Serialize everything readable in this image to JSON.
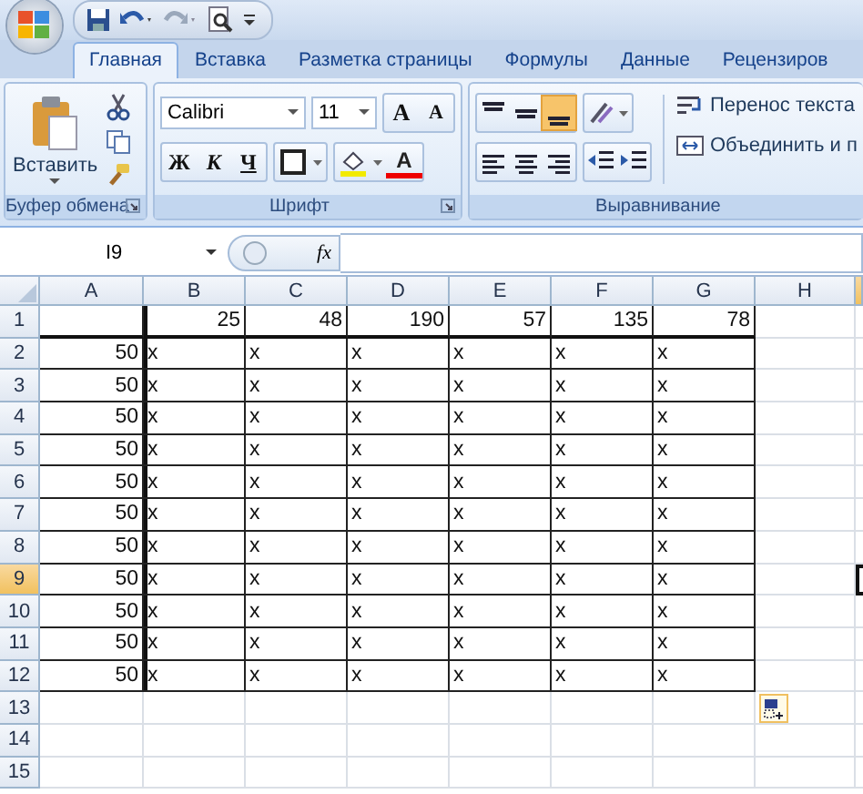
{
  "tabs": [
    {
      "label": "Главная",
      "selected": true
    },
    {
      "label": "Вставка",
      "selected": false
    },
    {
      "label": "Разметка страницы",
      "selected": false
    },
    {
      "label": "Формулы",
      "selected": false
    },
    {
      "label": "Данные",
      "selected": false
    },
    {
      "label": "Рецензиров",
      "selected": false
    }
  ],
  "ribbon": {
    "clipboard": {
      "paste_label": "Вставить",
      "group_label": "Буфер обмена"
    },
    "font": {
      "font_name": "Calibri",
      "font_size": "11",
      "grow_glyph": "A",
      "shrink_glyph": "A",
      "bold_glyph": "Ж",
      "italic_glyph": "К",
      "underline_glyph": "Ч",
      "color_glyph": "A",
      "group_label": "Шрифт"
    },
    "alignment": {
      "vertical_align": [
        {
          "selected": false
        },
        {
          "selected": false
        },
        {
          "selected": true
        }
      ],
      "wrap_label": "Перенос текста",
      "merge_label": "Объединить и п",
      "group_label": "Выравнивание"
    }
  },
  "formula_bar": {
    "name_box": "I9",
    "fx": "fx"
  },
  "sheet": {
    "columns": [
      {
        "label": "A",
        "selected": false
      },
      {
        "label": "B",
        "selected": false
      },
      {
        "label": "C",
        "selected": false
      },
      {
        "label": "D",
        "selected": false
      },
      {
        "label": "E",
        "selected": false
      },
      {
        "label": "F",
        "selected": false
      },
      {
        "label": "G",
        "selected": false
      },
      {
        "label": "H",
        "selected": false
      },
      {
        "selected": true
      }
    ],
    "rows": [
      {
        "label": "1",
        "selected": false,
        "bordered": true,
        "cells": [
          null,
          "25",
          "48",
          "190",
          "57",
          "135",
          "78"
        ]
      },
      {
        "label": "2",
        "selected": false,
        "bordered": true,
        "cells": [
          "50",
          "x",
          "x",
          "x",
          "x",
          "x",
          "x"
        ]
      },
      {
        "label": "3",
        "selected": false,
        "bordered": true,
        "cells": [
          "50",
          "x",
          "x",
          "x",
          "x",
          "x",
          "x"
        ]
      },
      {
        "label": "4",
        "selected": false,
        "bordered": true,
        "cells": [
          "50",
          "x",
          "x",
          "x",
          "x",
          "x",
          "x"
        ]
      },
      {
        "label": "5",
        "selected": false,
        "bordered": true,
        "cells": [
          "50",
          "x",
          "x",
          "x",
          "x",
          "x",
          "x"
        ]
      },
      {
        "label": "6",
        "selected": false,
        "bordered": true,
        "cells": [
          "50",
          "x",
          "x",
          "x",
          "x",
          "x",
          "x"
        ]
      },
      {
        "label": "7",
        "selected": false,
        "bordered": true,
        "cells": [
          "50",
          "x",
          "x",
          "x",
          "x",
          "x",
          "x"
        ]
      },
      {
        "label": "8",
        "selected": false,
        "bordered": true,
        "cells": [
          "50",
          "x",
          "x",
          "x",
          "x",
          "x",
          "x"
        ]
      },
      {
        "label": "9",
        "selected": true,
        "bordered": true,
        "cells": [
          "50",
          "x",
          "x",
          "x",
          "x",
          "x",
          "x"
        ]
      },
      {
        "label": "10",
        "selected": false,
        "bordered": true,
        "cells": [
          "50",
          "x",
          "x",
          "x",
          "x",
          "x",
          "x"
        ]
      },
      {
        "label": "11",
        "selected": false,
        "bordered": true,
        "cells": [
          "50",
          "x",
          "x",
          "x",
          "x",
          "x",
          "x"
        ]
      },
      {
        "label": "12",
        "selected": false,
        "bordered": true,
        "cells": [
          "50",
          "x",
          "x",
          "x",
          "x",
          "x",
          "x"
        ]
      },
      {
        "label": "13",
        "selected": false,
        "bordered": false
      },
      {
        "label": "14",
        "selected": false,
        "bordered": false
      },
      {
        "label": "15",
        "selected": false,
        "bordered": false
      }
    ]
  }
}
